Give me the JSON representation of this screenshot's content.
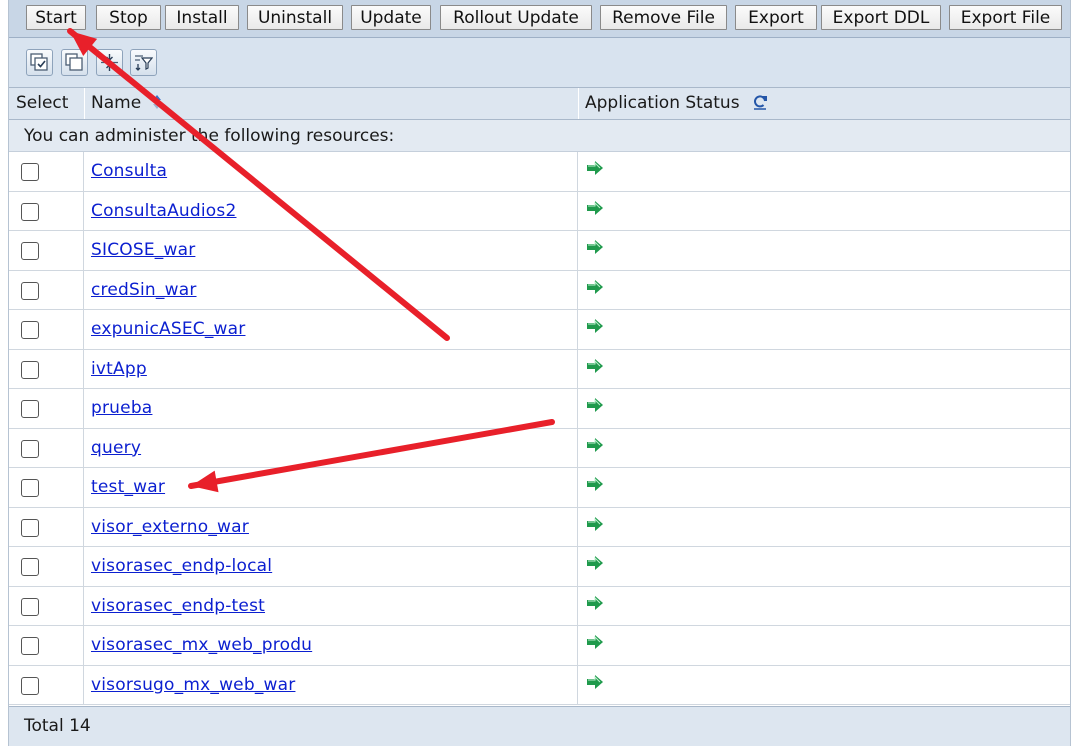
{
  "toolbar": {
    "buttons": [
      "Start",
      "Stop",
      "Install",
      "Uninstall",
      "Update",
      "Rollout Update",
      "Remove File",
      "Export",
      "Export DDL",
      "Export File"
    ]
  },
  "icon_toolbar": {
    "icons": [
      "select-all-icon",
      "deselect-all-icon",
      "expand-filter-icon",
      "show-filter-icon"
    ]
  },
  "table": {
    "columns": [
      "Select",
      "Name",
      "Application Status"
    ],
    "sort_icon": "sort-arrows-icon",
    "refresh_icon": "refresh-icon",
    "notice": "You can administer the following resources:",
    "status_icon": "started-arrow-icon",
    "status_color": "#1f9a4c",
    "rows": [
      {
        "name": "Consulta"
      },
      {
        "name": "ConsultaAudios2"
      },
      {
        "name": "SICOSE_war"
      },
      {
        "name": "credSin_war"
      },
      {
        "name": "expunicASEC_war"
      },
      {
        "name": "ivtApp"
      },
      {
        "name": "prueba"
      },
      {
        "name": "query"
      },
      {
        "name": "test_war"
      },
      {
        "name": "visor_externo_war"
      },
      {
        "name": "visorasec_endp-local"
      },
      {
        "name": "visorasec_endp-test"
      },
      {
        "name": "visorasec_mx_web_produ"
      },
      {
        "name": "visorsugo_mx_web_war"
      }
    ],
    "total_label": "Total 14"
  },
  "annotation": {
    "arrow_color": "#e8202a"
  }
}
